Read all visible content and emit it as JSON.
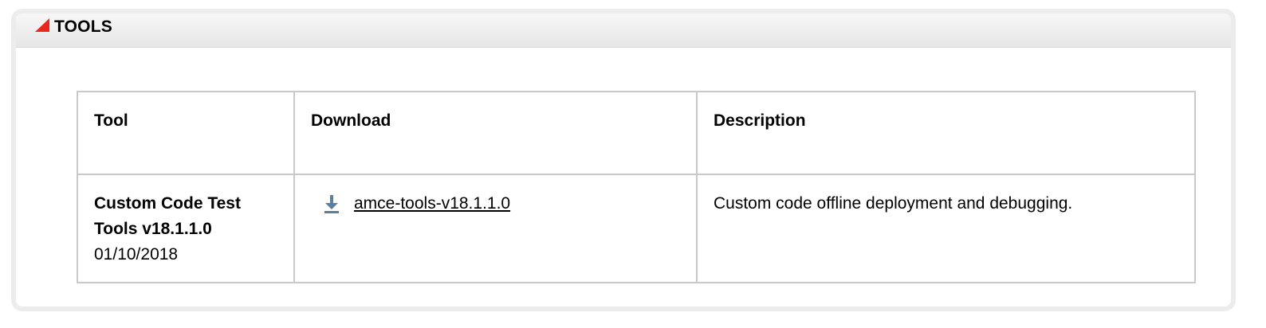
{
  "panel": {
    "title": "TOOLS",
    "accent_color": "#e8281e"
  },
  "table": {
    "headers": [
      "Tool",
      "Download",
      "Description"
    ],
    "rows": [
      {
        "tool_name": "Custom Code Test Tools v18.1.1.0",
        "tool_date": "01/10/2018",
        "download_label": "amce-tools-v18.1.1.0",
        "download_icon": "download-arrow-icon",
        "description": "Custom code offline deployment and debugging."
      }
    ]
  }
}
